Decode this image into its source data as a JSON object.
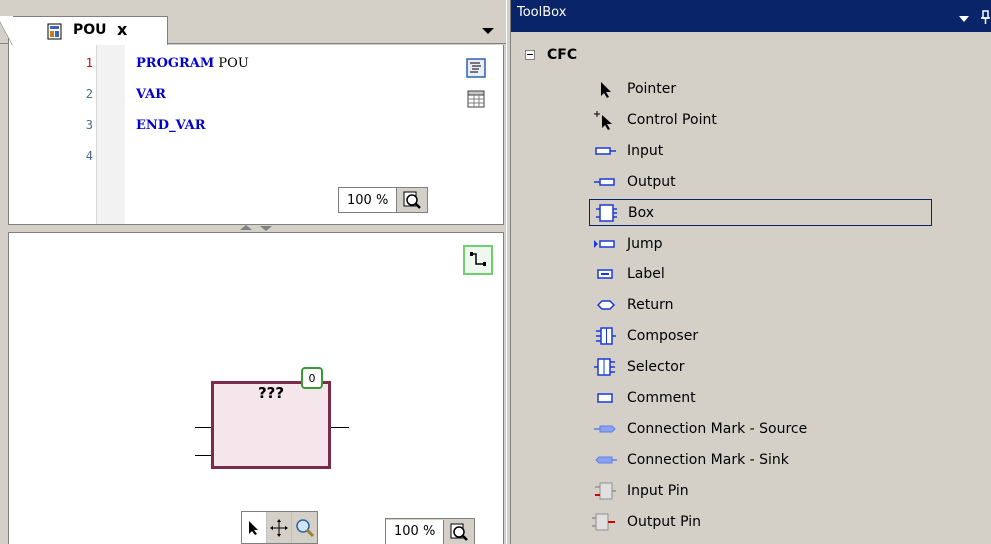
{
  "editor": {
    "tab_title": "POU",
    "tab_close": "x",
    "lines": [
      {
        "num": "1",
        "code": "PROGRAM POU"
      },
      {
        "num": "2",
        "code": "VAR"
      },
      {
        "num": "3",
        "code": "END_VAR"
      },
      {
        "num": "4",
        "code": ""
      }
    ],
    "line1_kw": "PROGRAM",
    "line1_ident": " POU",
    "line2_kw": "VAR",
    "line3_kw": "END_VAR",
    "zoom_top": "100 %",
    "zoom_bottom": "100 %"
  },
  "cfc": {
    "box_name": "???",
    "execution_order": "0"
  },
  "toolbox": {
    "title": "ToolBox",
    "category": "CFC",
    "items": [
      {
        "label": "Pointer",
        "icon": "pointer-arrow-icon"
      },
      {
        "label": "Control Point",
        "icon": "control-point-icon"
      },
      {
        "label": "Input",
        "icon": "input-element-icon"
      },
      {
        "label": "Output",
        "icon": "output-element-icon"
      },
      {
        "label": "Box",
        "icon": "box-element-icon"
      },
      {
        "label": "Jump",
        "icon": "jump-element-icon"
      },
      {
        "label": "Label",
        "icon": "label-element-icon"
      },
      {
        "label": "Return",
        "icon": "return-element-icon"
      },
      {
        "label": "Composer",
        "icon": "composer-element-icon"
      },
      {
        "label": "Selector",
        "icon": "selector-element-icon"
      },
      {
        "label": "Comment",
        "icon": "comment-element-icon"
      },
      {
        "label": "Connection Mark - Source",
        "icon": "connection-mark-source-icon"
      },
      {
        "label": "Connection Mark - Sink",
        "icon": "connection-mark-sink-icon"
      },
      {
        "label": "Input Pin",
        "icon": "input-pin-icon"
      },
      {
        "label": "Output Pin",
        "icon": "output-pin-icon"
      }
    ],
    "selected_item": "Box"
  },
  "colors": {
    "keyword": "#0000cc",
    "error_line": "#cc0000",
    "toolbox_header": "#0a246a",
    "box_border": "#7a2c4a",
    "box_fill": "#f5e6ec",
    "badge_border": "#3a9a3a",
    "element_blue": "#1a3ad8"
  }
}
